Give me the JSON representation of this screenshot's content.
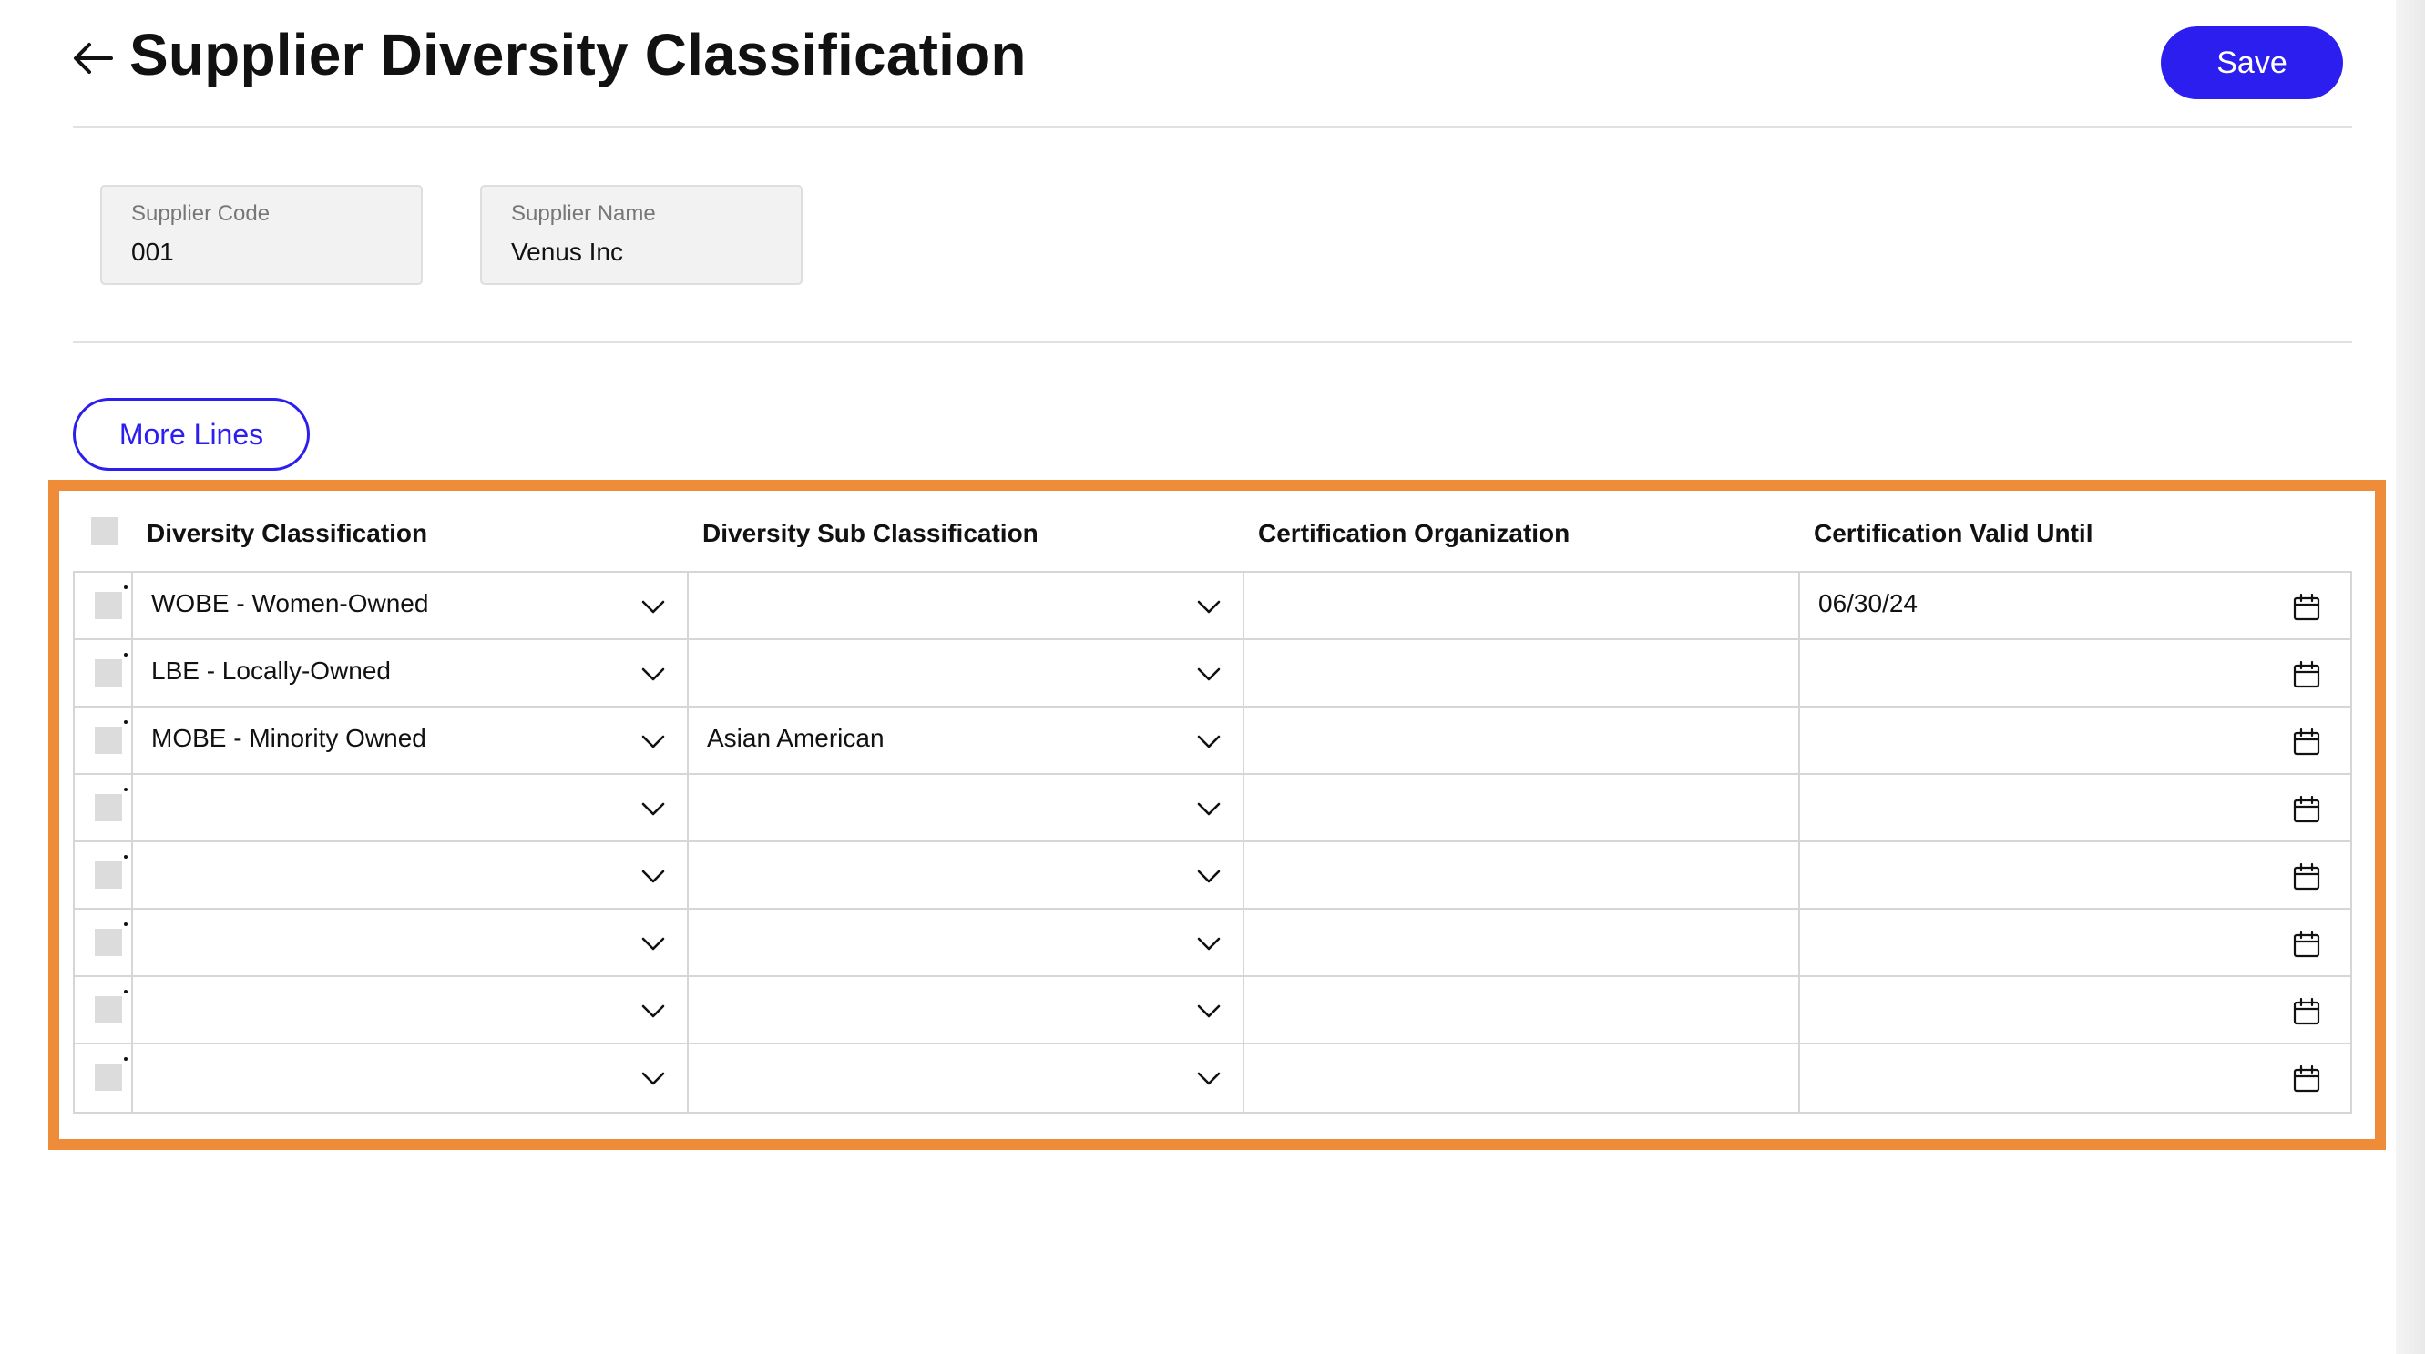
{
  "header": {
    "title": "Supplier Diversity Classification",
    "back_icon": "arrow-left-icon",
    "save_label": "Save"
  },
  "supplier": {
    "code_label": "Supplier Code",
    "code_value": "001",
    "name_label": "Supplier Name",
    "name_value": "Venus Inc"
  },
  "toolbar": {
    "more_lines_label": "More Lines"
  },
  "table": {
    "columns": [
      "Diversity Classification",
      "Diversity Sub Classification",
      "Certification Organization",
      "Certification Valid Until"
    ],
    "rows": [
      {
        "classification": "WOBE - Women-Owned",
        "sub_classification": "",
        "organization": "",
        "valid_until": "06/30/24"
      },
      {
        "classification": "LBE - Locally-Owned",
        "sub_classification": "",
        "organization": "",
        "valid_until": ""
      },
      {
        "classification": "MOBE - Minority Owned",
        "sub_classification": "Asian American",
        "organization": "",
        "valid_until": ""
      },
      {
        "classification": "",
        "sub_classification": "",
        "organization": "",
        "valid_until": ""
      },
      {
        "classification": "",
        "sub_classification": "",
        "organization": "",
        "valid_until": ""
      },
      {
        "classification": "",
        "sub_classification": "",
        "organization": "",
        "valid_until": ""
      },
      {
        "classification": "",
        "sub_classification": "",
        "organization": "",
        "valid_until": ""
      },
      {
        "classification": "",
        "sub_classification": "",
        "organization": "",
        "valid_until": ""
      }
    ]
  },
  "colors": {
    "accent": "#2d1ef0",
    "highlight": "#ee8c3a"
  }
}
